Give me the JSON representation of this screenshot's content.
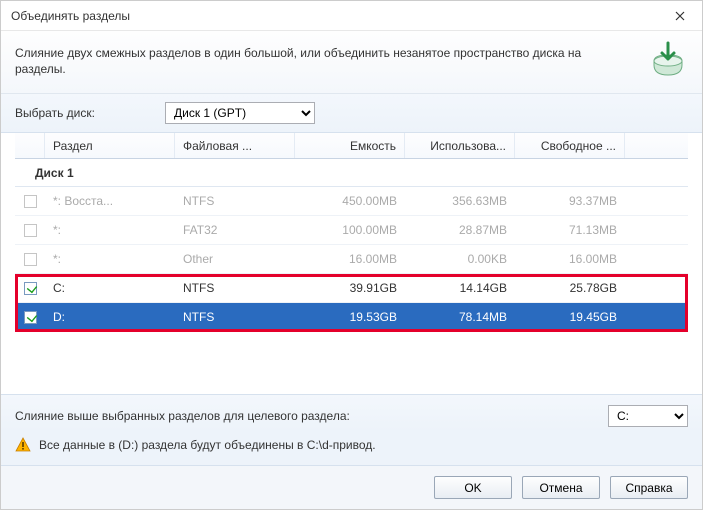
{
  "window": {
    "title": "Объединять разделы"
  },
  "description": "Слияние двух смежных разделов в один большой, или объединить незанятое пространство диска на разделы.",
  "disk_label": "Выбрать диск:",
  "disk_select": {
    "selected": "Диск 1 (GPT)"
  },
  "columns": {
    "partition": "Раздел",
    "fs": "Файловая ...",
    "capacity": "Емкость",
    "used": "Использова...",
    "free": "Свободное ..."
  },
  "group_label": "Диск 1",
  "rows": [
    {
      "enabled": false,
      "checked": false,
      "selected": false,
      "name": "*: Восста...",
      "fs": "NTFS",
      "cap": "450.00MB",
      "used": "356.63MB",
      "free": "93.37MB"
    },
    {
      "enabled": false,
      "checked": false,
      "selected": false,
      "name": "*:",
      "fs": "FAT32",
      "cap": "100.00MB",
      "used": "28.87MB",
      "free": "71.13MB"
    },
    {
      "enabled": false,
      "checked": false,
      "selected": false,
      "name": "*:",
      "fs": "Other",
      "cap": "16.00MB",
      "used": "0.00KB",
      "free": "16.00MB"
    },
    {
      "enabled": true,
      "checked": true,
      "selected": false,
      "name": "C:",
      "fs": "NTFS",
      "cap": "39.91GB",
      "used": "14.14GB",
      "free": "25.78GB"
    },
    {
      "enabled": true,
      "checked": true,
      "selected": true,
      "name": "D:",
      "fs": "NTFS",
      "cap": "19.53GB",
      "used": "78.14MB",
      "free": "19.45GB"
    }
  ],
  "target": {
    "label": "Слияние выше выбранных разделов для целевого раздела:",
    "selected": "C:"
  },
  "warning": "Все данные в (D:) раздела будут объединены в C:\\d-привод.",
  "buttons": {
    "ok": "OK",
    "cancel": "Отмена",
    "help": "Справка"
  }
}
